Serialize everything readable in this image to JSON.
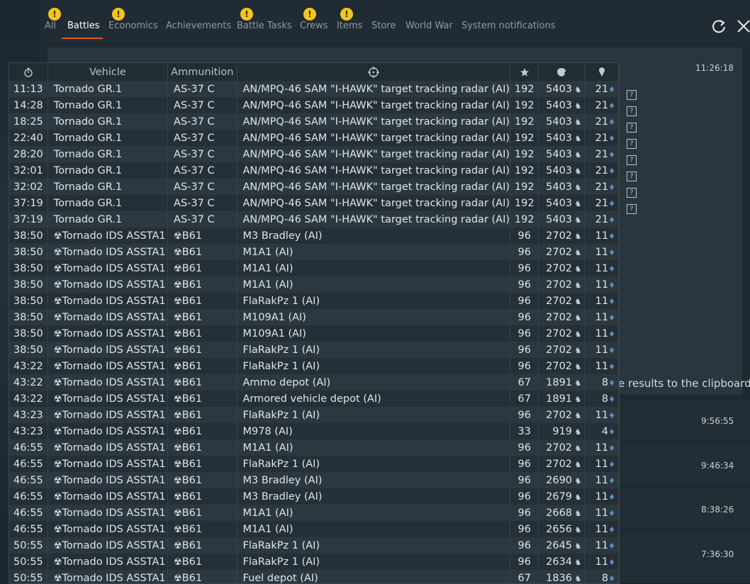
{
  "tabs": [
    {
      "label": "All",
      "warn": true
    },
    {
      "label": "Battles",
      "warn": false,
      "active": true
    },
    {
      "label": "Economics",
      "warn": true
    },
    {
      "label": "Achievements",
      "warn": false
    },
    {
      "label": "Battle Tasks",
      "warn": true
    },
    {
      "label": "Crews",
      "warn": true
    },
    {
      "label": "Items",
      "warn": true
    },
    {
      "label": "Store",
      "warn": false
    },
    {
      "label": "World War",
      "warn": false
    },
    {
      "label": "System notifications",
      "warn": false
    }
  ],
  "warn_glyph": "!",
  "background": {
    "times": [
      "11:26:18",
      "9:56:55",
      "9:46:34",
      "8:38:26",
      "7:36:30"
    ],
    "clipboard_text": "e results to the clipboard",
    "help_glyph": "?"
  },
  "table": {
    "headers": {
      "vehicle": "Vehicle",
      "ammunition": "Ammunition"
    },
    "header_icons": [
      "stopwatch-icon",
      "crosshair-icon",
      "star-icon",
      "lion-icon",
      "pin-icon"
    ],
    "rows": [
      [
        "11:13",
        "Tornado GR.1",
        "AS-37 C",
        "AN/MPQ-46 SAM \"I-HAWK\" target tracking radar (AI)",
        "192",
        "5403",
        "21",
        false
      ],
      [
        "14:28",
        "Tornado GR.1",
        "AS-37 C",
        "AN/MPQ-46 SAM \"I-HAWK\" target tracking radar (AI)",
        "192",
        "5403",
        "21",
        false
      ],
      [
        "18:25",
        "Tornado GR.1",
        "AS-37 C",
        "AN/MPQ-46 SAM \"I-HAWK\" target tracking radar (AI)",
        "192",
        "5403",
        "21",
        false
      ],
      [
        "22:40",
        "Tornado GR.1",
        "AS-37 C",
        "AN/MPQ-46 SAM \"I-HAWK\" target tracking radar (AI)",
        "192",
        "5403",
        "21",
        false
      ],
      [
        "28:20",
        "Tornado GR.1",
        "AS-37 C",
        "AN/MPQ-46 SAM \"I-HAWK\" target tracking radar (AI)",
        "192",
        "5403",
        "21",
        false
      ],
      [
        "32:01",
        "Tornado GR.1",
        "AS-37 C",
        "AN/MPQ-46 SAM \"I-HAWK\" target tracking radar (AI)",
        "192",
        "5403",
        "21",
        false
      ],
      [
        "32:02",
        "Tornado GR.1",
        "AS-37 C",
        "AN/MPQ-46 SAM \"I-HAWK\" target tracking radar (AI)",
        "192",
        "5403",
        "21",
        false
      ],
      [
        "37:19",
        "Tornado GR.1",
        "AS-37 C",
        "AN/MPQ-46 SAM \"I-HAWK\" target tracking radar (AI)",
        "192",
        "5403",
        "21",
        false
      ],
      [
        "37:19",
        "Tornado GR.1",
        "AS-37 C",
        "AN/MPQ-46 SAM \"I-HAWK\" target tracking radar (AI)",
        "192",
        "5403",
        "21",
        false
      ],
      [
        "38:50",
        "Tornado IDS ASSTA1",
        "B61",
        "M3 Bradley (AI)",
        "96",
        "2702",
        "11",
        true
      ],
      [
        "38:50",
        "Tornado IDS ASSTA1",
        "B61",
        "M1A1 (AI)",
        "96",
        "2702",
        "11",
        true
      ],
      [
        "38:50",
        "Tornado IDS ASSTA1",
        "B61",
        "M1A1 (AI)",
        "96",
        "2702",
        "11",
        true
      ],
      [
        "38:50",
        "Tornado IDS ASSTA1",
        "B61",
        "M1A1 (AI)",
        "96",
        "2702",
        "11",
        true
      ],
      [
        "38:50",
        "Tornado IDS ASSTA1",
        "B61",
        "FlaRakPz 1 (AI)",
        "96",
        "2702",
        "11",
        true
      ],
      [
        "38:50",
        "Tornado IDS ASSTA1",
        "B61",
        "M109A1 (AI)",
        "96",
        "2702",
        "11",
        true
      ],
      [
        "38:50",
        "Tornado IDS ASSTA1",
        "B61",
        "M109A1 (AI)",
        "96",
        "2702",
        "11",
        true
      ],
      [
        "38:50",
        "Tornado IDS ASSTA1",
        "B61",
        "FlaRakPz 1 (AI)",
        "96",
        "2702",
        "11",
        true
      ],
      [
        "43:22",
        "Tornado IDS ASSTA1",
        "B61",
        "FlaRakPz 1 (AI)",
        "96",
        "2702",
        "11",
        true
      ],
      [
        "43:22",
        "Tornado IDS ASSTA1",
        "B61",
        "Ammo depot (AI)",
        "67",
        "1891",
        "8",
        true
      ],
      [
        "43:22",
        "Tornado IDS ASSTA1",
        "B61",
        "Armored vehicle depot (AI)",
        "67",
        "1891",
        "8",
        true
      ],
      [
        "43:23",
        "Tornado IDS ASSTA1",
        "B61",
        "FlaRakPz 1 (AI)",
        "96",
        "2702",
        "11",
        true
      ],
      [
        "43:23",
        "Tornado IDS ASSTA1",
        "B61",
        "M978 (AI)",
        "33",
        "919",
        "4",
        true
      ],
      [
        "46:55",
        "Tornado IDS ASSTA1",
        "B61",
        "M1A1 (AI)",
        "96",
        "2702",
        "11",
        true
      ],
      [
        "46:55",
        "Tornado IDS ASSTA1",
        "B61",
        "FlaRakPz 1 (AI)",
        "96",
        "2702",
        "11",
        true
      ],
      [
        "46:55",
        "Tornado IDS ASSTA1",
        "B61",
        "M3 Bradley (AI)",
        "96",
        "2690",
        "11",
        true
      ],
      [
        "46:55",
        "Tornado IDS ASSTA1",
        "B61",
        "M3 Bradley (AI)",
        "96",
        "2679",
        "11",
        true
      ],
      [
        "46:55",
        "Tornado IDS ASSTA1",
        "B61",
        "M1A1 (AI)",
        "96",
        "2668",
        "11",
        true
      ],
      [
        "46:55",
        "Tornado IDS ASSTA1",
        "B61",
        "M1A1 (AI)",
        "96",
        "2656",
        "11",
        true
      ],
      [
        "50:55",
        "Tornado IDS ASSTA1",
        "B61",
        "FlaRakPz 1 (AI)",
        "96",
        "2645",
        "11",
        true
      ],
      [
        "50:55",
        "Tornado IDS ASSTA1",
        "B61",
        "FlaRakPz 1 (AI)",
        "96",
        "2634",
        "11",
        true
      ],
      [
        "50:55",
        "Tornado IDS ASSTA1",
        "B61",
        "Fuel depot (AI)",
        "67",
        "1836",
        "8",
        true
      ]
    ]
  },
  "colors": {
    "accent": "#e0532a",
    "warning": "#f4c51c",
    "pin": "#5a8fc7"
  }
}
